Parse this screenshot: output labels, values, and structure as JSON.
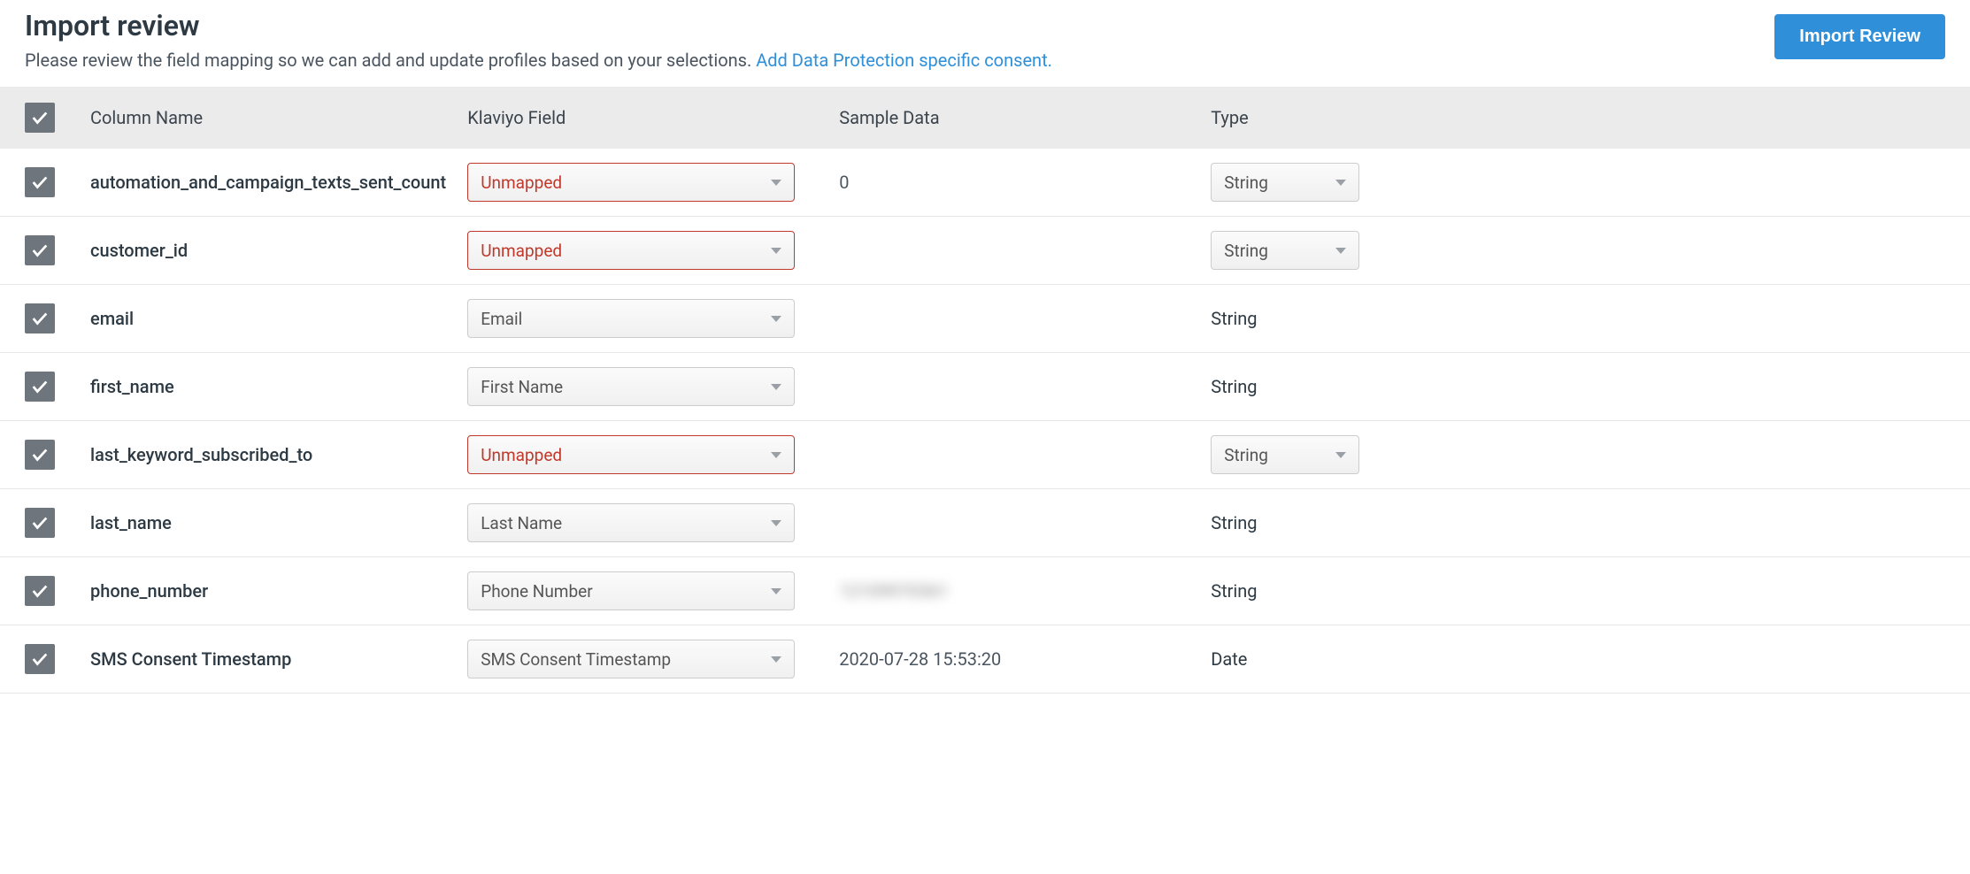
{
  "header": {
    "title": "Import review",
    "subtitle_prefix": "Please review the field mapping so we can add and update profiles based on your selections. ",
    "subtitle_link": "Add Data Protection specific consent.",
    "button_label": "Import Review"
  },
  "table": {
    "headers": {
      "column_name": "Column Name",
      "klaviyo_field": "Klaviyo Field",
      "sample_data": "Sample Data",
      "type": "Type"
    },
    "rows": [
      {
        "checked": true,
        "column_name": "automation_and_campaign_texts_sent_count",
        "field": "Unmapped",
        "field_unmapped": true,
        "sample": "0",
        "sample_blurred": false,
        "type": "String",
        "type_editable": true
      },
      {
        "checked": true,
        "column_name": "customer_id",
        "field": "Unmapped",
        "field_unmapped": true,
        "sample": "",
        "sample_blurred": false,
        "type": "String",
        "type_editable": true
      },
      {
        "checked": true,
        "column_name": "email",
        "field": "Email",
        "field_unmapped": false,
        "sample": "",
        "sample_blurred": false,
        "type": "String",
        "type_editable": false
      },
      {
        "checked": true,
        "column_name": "first_name",
        "field": "First Name",
        "field_unmapped": false,
        "sample": "",
        "sample_blurred": false,
        "type": "String",
        "type_editable": false
      },
      {
        "checked": true,
        "column_name": "last_keyword_subscribed_to",
        "field": "Unmapped",
        "field_unmapped": true,
        "sample": "",
        "sample_blurred": false,
        "type": "String",
        "type_editable": true
      },
      {
        "checked": true,
        "column_name": "last_name",
        "field": "Last Name",
        "field_unmapped": false,
        "sample": "",
        "sample_blurred": false,
        "type": "String",
        "type_editable": false
      },
      {
        "checked": true,
        "column_name": "phone_number",
        "field": "Phone Number",
        "field_unmapped": false,
        "sample": "12109970361",
        "sample_blurred": true,
        "type": "String",
        "type_editable": false
      },
      {
        "checked": true,
        "column_name": "SMS Consent Timestamp",
        "field": "SMS Consent Timestamp",
        "field_unmapped": false,
        "sample": "2020-07-28 15:53:20",
        "sample_blurred": false,
        "type": "Date",
        "type_editable": false
      }
    ]
  }
}
